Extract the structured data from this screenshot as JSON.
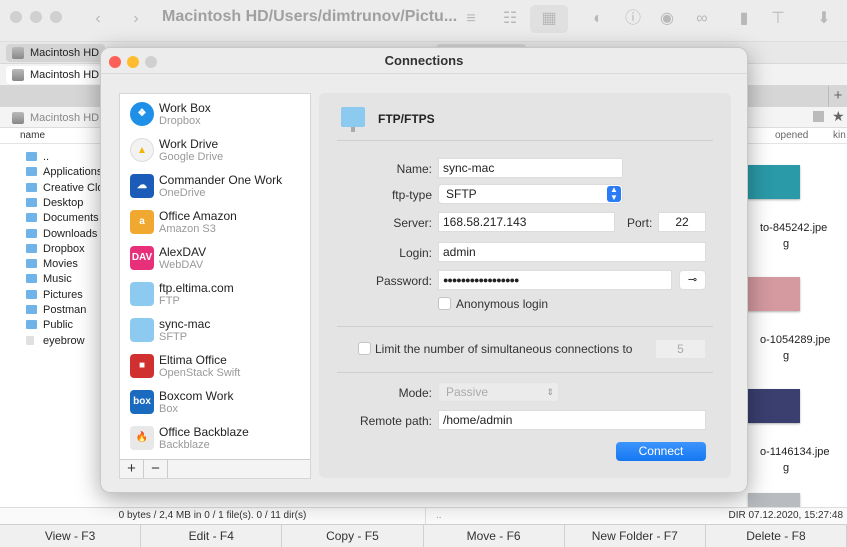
{
  "toolbar": {
    "path": "Macintosh HD/Users/dimtrunov/Pictu...",
    "icons": [
      "chevron-left-icon",
      "chevron-right-icon",
      "list-icon",
      "detail-list-icon",
      "grid-icon",
      "toggle-icon",
      "info-icon",
      "eye-icon",
      "binoculars-icon",
      "archive-icon",
      "network-icon",
      "download-icon"
    ]
  },
  "left_pane": {
    "tab1": "Macintosh HD",
    "tab2": "Macintosh HD",
    "path": "Macintosh HD",
    "column": "name",
    "files": [
      "..",
      "Applications",
      "Creative Cloud",
      "Desktop",
      "Documents",
      "Downloads",
      "Dropbox",
      "Movies",
      "Music",
      "Pictures",
      "Postman",
      "Public",
      "eyebrow"
    ],
    "status": "0 bytes / 2,4 MB in 0 / 1 file(s). 0 / 11 dir(s)"
  },
  "right_pane": {
    "columns": [
      "opened",
      "kin"
    ],
    "add_tab": "+",
    "thumbs": [
      {
        "l1": "to-845242.jpe",
        "l2": "g",
        "color": "#2a9aa8"
      },
      {
        "l1": "o-1054289.jpe",
        "l2": "g",
        "color": "#d49aa0"
      },
      {
        "l1": "o-1146134.jpe",
        "l2": "g",
        "color": "#3a3f70"
      }
    ],
    "status_left": "..",
    "status_right": "DIR  07.12.2020, 15:27:48"
  },
  "fkeys": [
    "View - F3",
    "Edit - F4",
    "Copy - F5",
    "Move - F6",
    "New Folder - F7",
    "Delete - F8"
  ],
  "dialog": {
    "title": "Connections",
    "connections": [
      {
        "name": "Work Box",
        "type": "Dropbox",
        "icon": "dropbox-icon",
        "color": "#1e90e8",
        "glyph": "❖"
      },
      {
        "name": "Work Drive",
        "type": "Google Drive",
        "icon": "google-drive-icon",
        "color": "#f2f2f2",
        "glyph": "▲"
      },
      {
        "name": "Commander One Work",
        "type": "OneDrive",
        "icon": "onedrive-icon",
        "color": "#1a5cb8",
        "glyph": "☁"
      },
      {
        "name": "Office Amazon",
        "type": "Amazon S3",
        "icon": "amazon-s3-icon",
        "color": "#f0a830",
        "glyph": "a"
      },
      {
        "name": "AlexDAV",
        "type": "WebDAV",
        "icon": "webdav-icon",
        "color": "#e8307a",
        "glyph": "DAV"
      },
      {
        "name": "ftp.eltima.com",
        "type": "FTP",
        "icon": "ftp-folder-icon",
        "color": "#8ccaf0",
        "glyph": ""
      },
      {
        "name": "sync-mac",
        "type": "SFTP",
        "icon": "sftp-folder-icon",
        "color": "#8ccaf0",
        "glyph": ""
      },
      {
        "name": "Eltima Office",
        "type": "OpenStack Swift",
        "icon": "openstack-icon",
        "color": "#d03030",
        "glyph": "■"
      },
      {
        "name": "Boxcom Work",
        "type": "Box",
        "icon": "box-icon",
        "color": "#1a6ac0",
        "glyph": "box"
      },
      {
        "name": "Office Backblaze",
        "type": "Backblaze",
        "icon": "backblaze-icon",
        "color": "#e8e8e8",
        "glyph": "🔥"
      }
    ],
    "add": "+",
    "remove": "−",
    "form": {
      "header": "FTP/FTPS",
      "name_label": "Name:",
      "name": "sync-mac",
      "type_label": "ftp-type",
      "type": "SFTP",
      "server_label": "Server:",
      "server": "168.58.217.143",
      "port_label": "Port:",
      "port": "22",
      "login_label": "Login:",
      "login": "admin",
      "password_label": "Password:",
      "password": "●●●●●●●●●●●●●●●●●",
      "anonymous": "Anonymous login",
      "anonymous_checked": false,
      "limit": "Limit the number of simultaneous connections to",
      "limit_checked": false,
      "limit_value": "5",
      "mode_label": "Mode:",
      "mode": "Passive",
      "remote_label": "Remote path:",
      "remote": "/home/admin",
      "connect": "Connect"
    }
  }
}
